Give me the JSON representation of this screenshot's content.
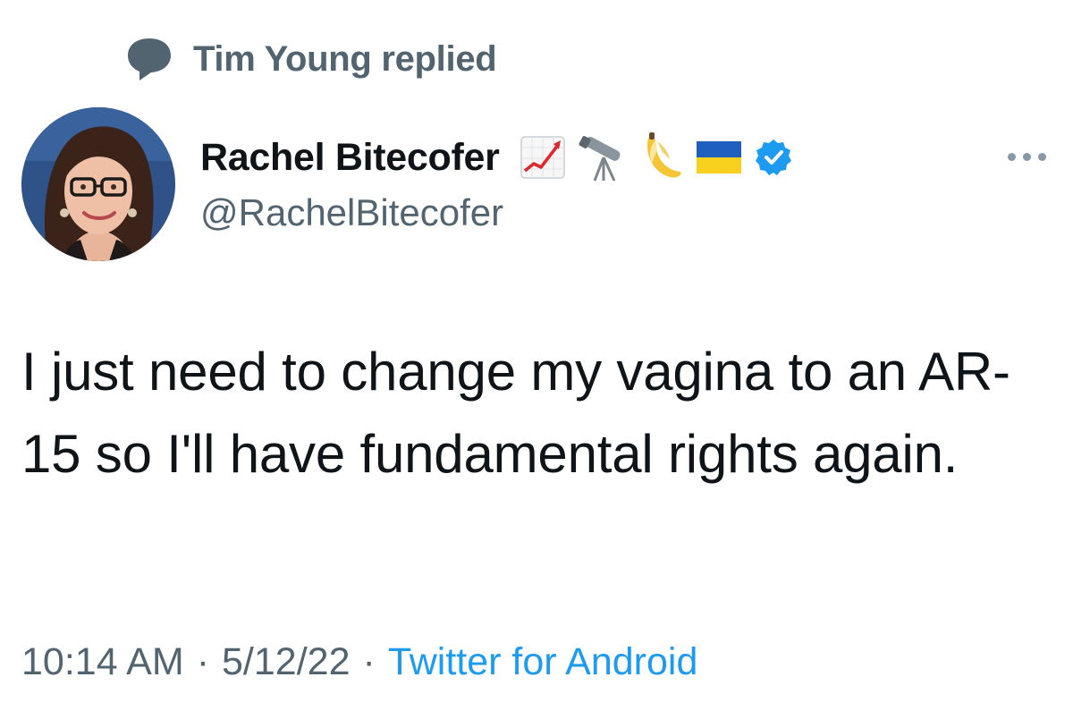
{
  "context": {
    "label": "Tim Young replied",
    "icon": "speech-bubble-icon"
  },
  "author": {
    "display_name": "Rachel Bitecofer",
    "handle": "@RachelBitecofer",
    "emojis": [
      "chart-increasing-icon",
      "telescope-icon",
      "banana-icon",
      "ukraine-flag-icon"
    ],
    "verified": true
  },
  "tweet": {
    "text": "I just need to change my vagina to an AR-15 so I'll have fundamental rights again."
  },
  "meta": {
    "time": "10:14 AM",
    "separator": "·",
    "date": "5/12/22",
    "source": "Twitter for Android"
  },
  "colors": {
    "text": "#0f1419",
    "secondary": "#536471",
    "link": "#1d9bf0",
    "verified": "#1d9bf0"
  }
}
